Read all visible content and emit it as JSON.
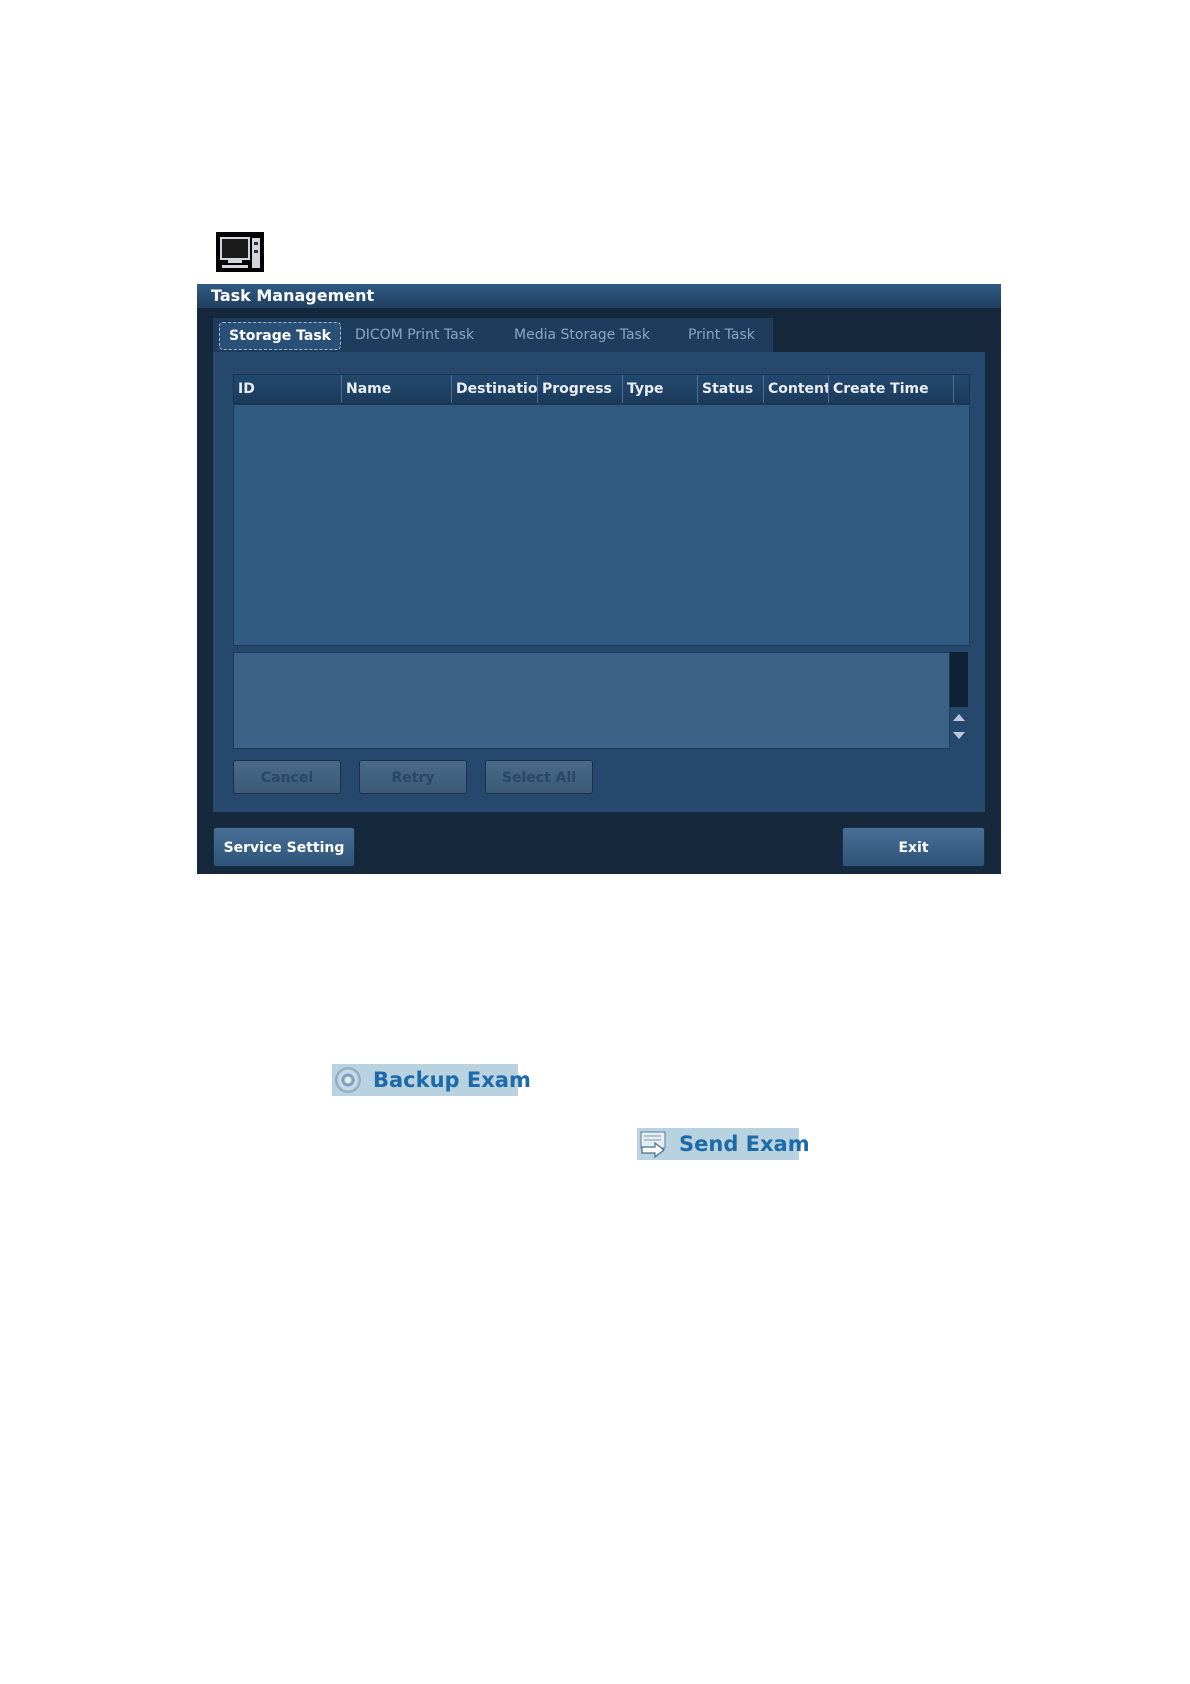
{
  "window": {
    "title": "Task Management"
  },
  "tabs": [
    {
      "label": "Storage Task",
      "active": true
    },
    {
      "label": "DICOM Print Task",
      "active": false
    },
    {
      "label": "Media Storage Task",
      "active": false
    },
    {
      "label": "Print Task",
      "active": false
    }
  ],
  "table": {
    "columns": [
      "ID",
      "Name",
      "Destination",
      "Progress",
      "Type",
      "Status",
      "Content",
      "Create Time"
    ],
    "rows": []
  },
  "actions": {
    "cancel_label": "Cancel",
    "retry_label": "Retry",
    "select_all_label": "Select All"
  },
  "footer": {
    "service_setting_label": "Service Setting",
    "exit_label": "Exit"
  },
  "page_buttons": {
    "backup_exam_label": "Backup Exam",
    "send_exam_label": "Send Exam"
  },
  "icons": {
    "monitor": "monitor-computer-icon",
    "backup": "disc-icon",
    "send": "send-arrow-icon"
  },
  "colors": {
    "window_bg": "#16283c",
    "panel_bg": "#26486c",
    "header_text": "#e9eef4",
    "button_label_blue": "#1c6aa8"
  }
}
